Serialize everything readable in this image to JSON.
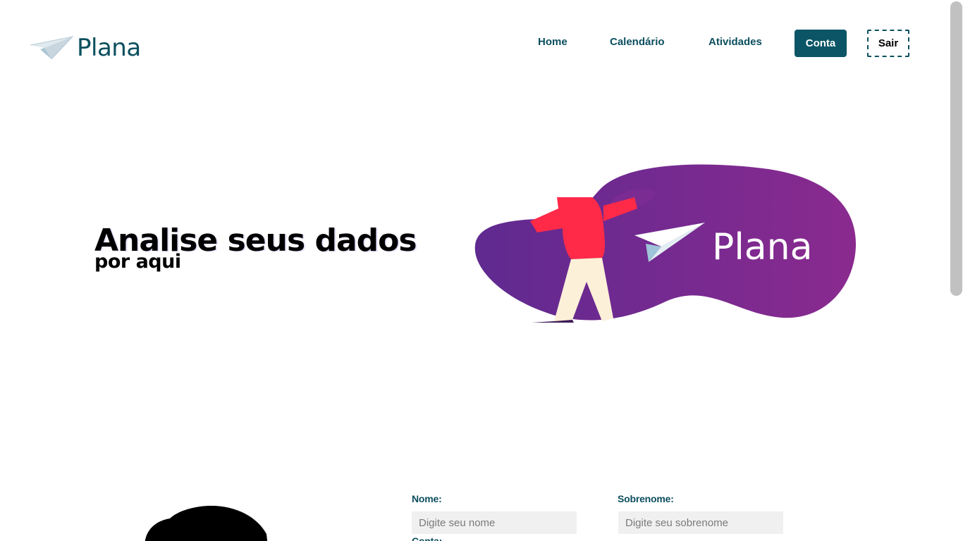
{
  "brand": {
    "name": "Plana",
    "color": "#0b4f5e",
    "accent_purple": "#7b2d9a"
  },
  "nav": {
    "home": "Home",
    "calendario": "Calendário",
    "atividades": "Atividades",
    "conta": "Conta",
    "sair": "Sair"
  },
  "hero": {
    "title": "Analise seus dados",
    "subtitle": "por aqui",
    "illustration_brand": "Plana"
  },
  "form": {
    "nome_label": "Nome:",
    "nome_placeholder": "Digite seu nome",
    "sobrenome_label": "Sobrenome:",
    "sobrenome_placeholder": "Digite seu sobrenome",
    "conta_label": "Conta:"
  }
}
